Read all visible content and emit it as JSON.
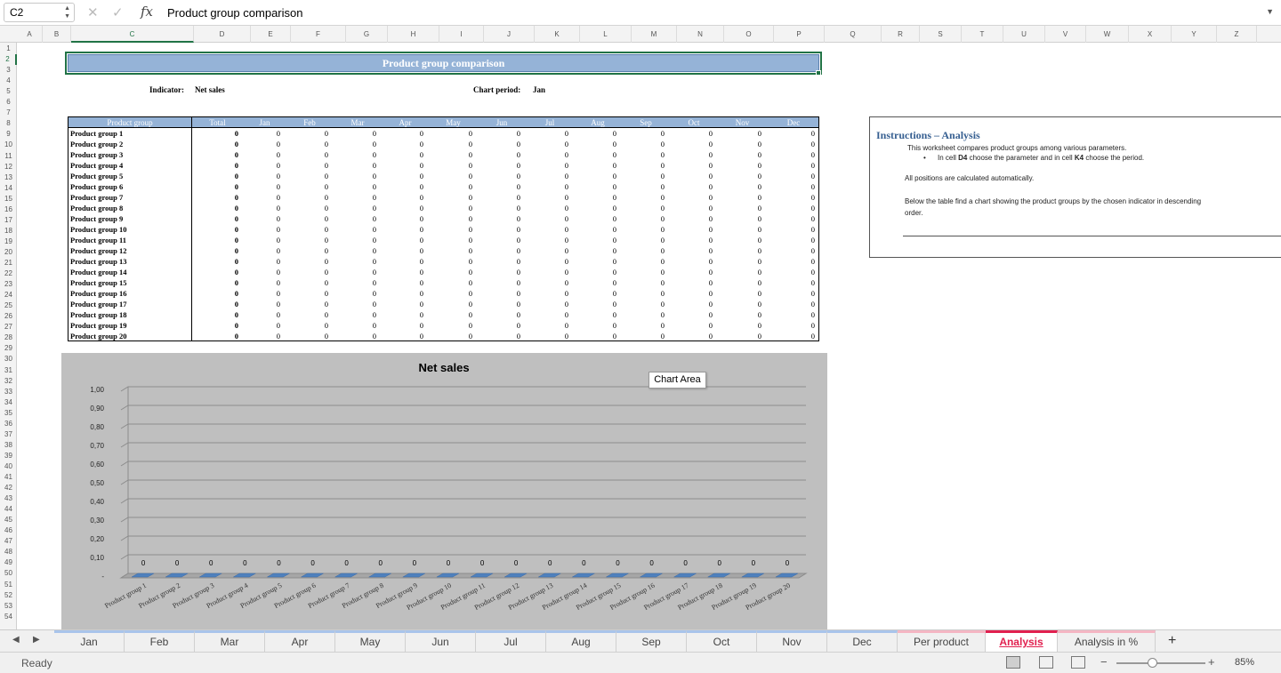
{
  "formula_bar": {
    "name_box": "C2",
    "fx_label": "fx",
    "content": "Product group comparison",
    "cancel_icon": "x-icon",
    "confirm_icon": "check-icon"
  },
  "columns": [
    "A",
    "B",
    "C",
    "D",
    "E",
    "F",
    "G",
    "H",
    "I",
    "J",
    "K",
    "L",
    "M",
    "N",
    "O",
    "P",
    "Q",
    "R",
    "S",
    "T",
    "U",
    "V",
    "W",
    "X",
    "Y",
    "Z"
  ],
  "rows": [
    "1",
    "2",
    "3",
    "4",
    "5",
    "6",
    "7",
    "8",
    "9",
    "10",
    "11",
    "12",
    "13",
    "14",
    "15",
    "16",
    "17",
    "18",
    "19",
    "20",
    "21",
    "22",
    "23",
    "24",
    "25",
    "26",
    "27",
    "28",
    "29",
    "30",
    "31",
    "32",
    "33",
    "34",
    "35",
    "36",
    "37",
    "38",
    "39",
    "40",
    "41",
    "42",
    "43",
    "44",
    "45",
    "46",
    "47",
    "48",
    "49",
    "50",
    "51",
    "52",
    "53",
    "54"
  ],
  "sheet": {
    "title": "Product group comparison",
    "indicator_label": "Indicator:",
    "indicator_value": "Net sales",
    "period_label": "Chart period:",
    "period_value": "Jan",
    "table_headers": [
      "Product group",
      "Total",
      "Jan",
      "Feb",
      "Mar",
      "Apr",
      "May",
      "Jun",
      "Jul",
      "Aug",
      "Sep",
      "Oct",
      "Nov",
      "Dec"
    ],
    "products": [
      "Product group 1",
      "Product group 2",
      "Product group 3",
      "Product group 4",
      "Product group 5",
      "Product group 6",
      "Product group 7",
      "Product group 8",
      "Product group 9",
      "Product group 10",
      "Product group 11",
      "Product group 12",
      "Product group 13",
      "Product group 14",
      "Product group 15",
      "Product group 16",
      "Product group 17",
      "Product group 18",
      "Product group 19",
      "Product group 20"
    ],
    "cell_value": "0"
  },
  "instructions": {
    "title": "Instructions – Analysis",
    "line1": "This worksheet compares product groups among various parameters.",
    "bullet": "•",
    "line2_a": "In cell ",
    "line2_b": "D4",
    "line2_c": " choose the parameter and in cell ",
    "line2_d": "K4",
    "line2_e": " choose the period.",
    "line3": "All positions are calculated automatically.",
    "line4": "Below the table find a chart showing the product groups by the chosen indicator in descending",
    "line5": "order."
  },
  "chart_tooltip": "Chart Area",
  "chart_data": {
    "type": "bar",
    "title": "Net sales",
    "categories": [
      "Product group 1",
      "Product group 2",
      "Product group 3",
      "Product group 4",
      "Product group 5",
      "Product group 6",
      "Product group 7",
      "Product group 8",
      "Product group 9",
      "Product group 10",
      "Product group 11",
      "Product group 12",
      "Product group 13",
      "Product group 14",
      "Product group 15",
      "Product group 16",
      "Product group 17",
      "Product group 18",
      "Product group 19",
      "Product group 20"
    ],
    "values": [
      0,
      0,
      0,
      0,
      0,
      0,
      0,
      0,
      0,
      0,
      0,
      0,
      0,
      0,
      0,
      0,
      0,
      0,
      0,
      0
    ],
    "yticks": [
      "-",
      "0,10",
      "0,20",
      "0,30",
      "0,40",
      "0,50",
      "0,60",
      "0,70",
      "0,80",
      "0,90",
      "1,00"
    ],
    "ylim": [
      0,
      1
    ],
    "grid": true,
    "legend": "none",
    "bar_color": "#4f81bd",
    "background": "#bfbfbf"
  },
  "tabs": [
    {
      "label": "Jan",
      "style": "blue"
    },
    {
      "label": "Feb",
      "style": "blue"
    },
    {
      "label": "Mar",
      "style": "blue"
    },
    {
      "label": "Apr",
      "style": "blue"
    },
    {
      "label": "May",
      "style": "blue"
    },
    {
      "label": "Jun",
      "style": "blue"
    },
    {
      "label": "Jul",
      "style": "blue"
    },
    {
      "label": "Aug",
      "style": "blue"
    },
    {
      "label": "Sep",
      "style": "blue"
    },
    {
      "label": "Oct",
      "style": "blue"
    },
    {
      "label": "Nov",
      "style": "blue"
    },
    {
      "label": "Dec",
      "style": "blue"
    },
    {
      "label": "Per product",
      "style": "pink"
    },
    {
      "label": "Analysis",
      "style": "active"
    },
    {
      "label": "Analysis in %",
      "style": "pink"
    }
  ],
  "add_sheet": "+",
  "status": {
    "ready": "Ready",
    "zoom": "85%",
    "zoom_minus": "−",
    "zoom_plus": "+"
  }
}
